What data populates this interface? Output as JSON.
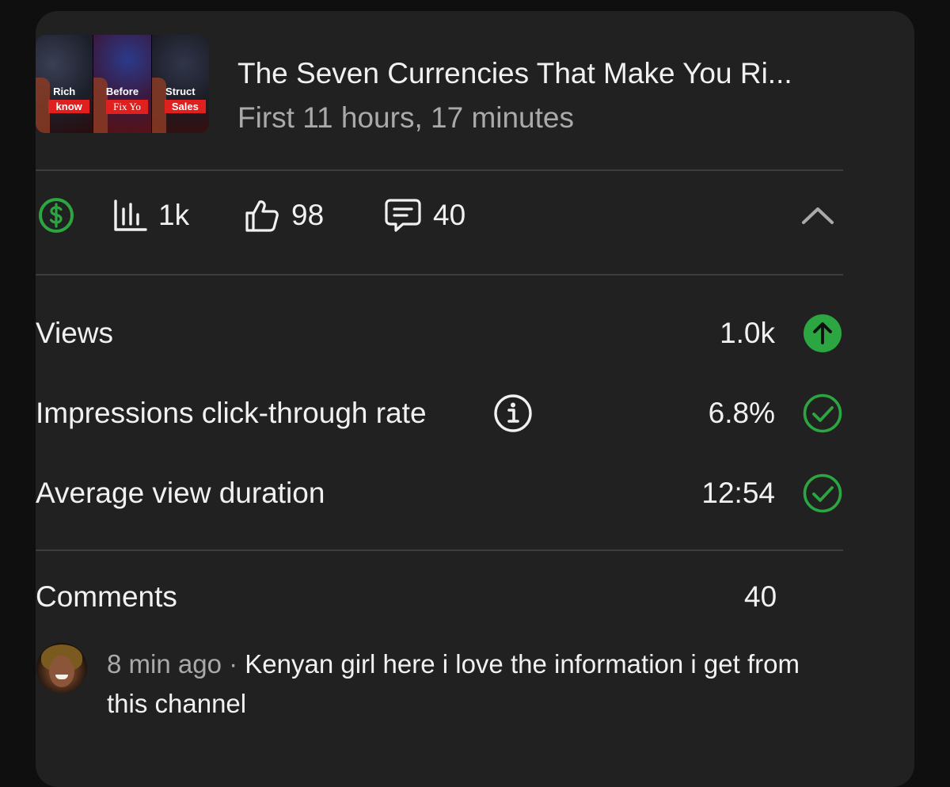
{
  "video": {
    "title": "The Seven Currencies That Make You Ri...",
    "subtitle": "First 11 hours, 17 minutes",
    "thumbnail_texts": [
      {
        "top": "Rich",
        "bottom": "know"
      },
      {
        "top": "Before",
        "bottom": "Fix Yo"
      },
      {
        "top": "Struct",
        "bottom": "Sales"
      }
    ]
  },
  "stats": {
    "monetization_icon": "dollar-circle-icon",
    "views": "1k",
    "likes": "98",
    "comments": "40",
    "collapse_icon": "chevron-up-icon"
  },
  "metrics": [
    {
      "label": "Views",
      "value": "1.0k",
      "status": "trending-up",
      "info": false
    },
    {
      "label": "Impressions click-through rate",
      "value": "6.8%",
      "status": "check",
      "info": true
    },
    {
      "label": "Average view duration",
      "value": "12:54",
      "status": "check",
      "info": false
    }
  ],
  "comments_section": {
    "title": "Comments",
    "count": "40",
    "latest": {
      "time": "8 min ago",
      "separator": " · ",
      "text": "Kenyan girl here i love the information i get from this channel"
    }
  },
  "colors": {
    "background": "#0f0f0f",
    "card": "#212121",
    "divider": "#3d3d3d",
    "text_primary": "#f1f1f1",
    "text_secondary": "#aaaaaa",
    "status_green": "#2ba640",
    "thumbnail_red": "#e01f1f"
  }
}
